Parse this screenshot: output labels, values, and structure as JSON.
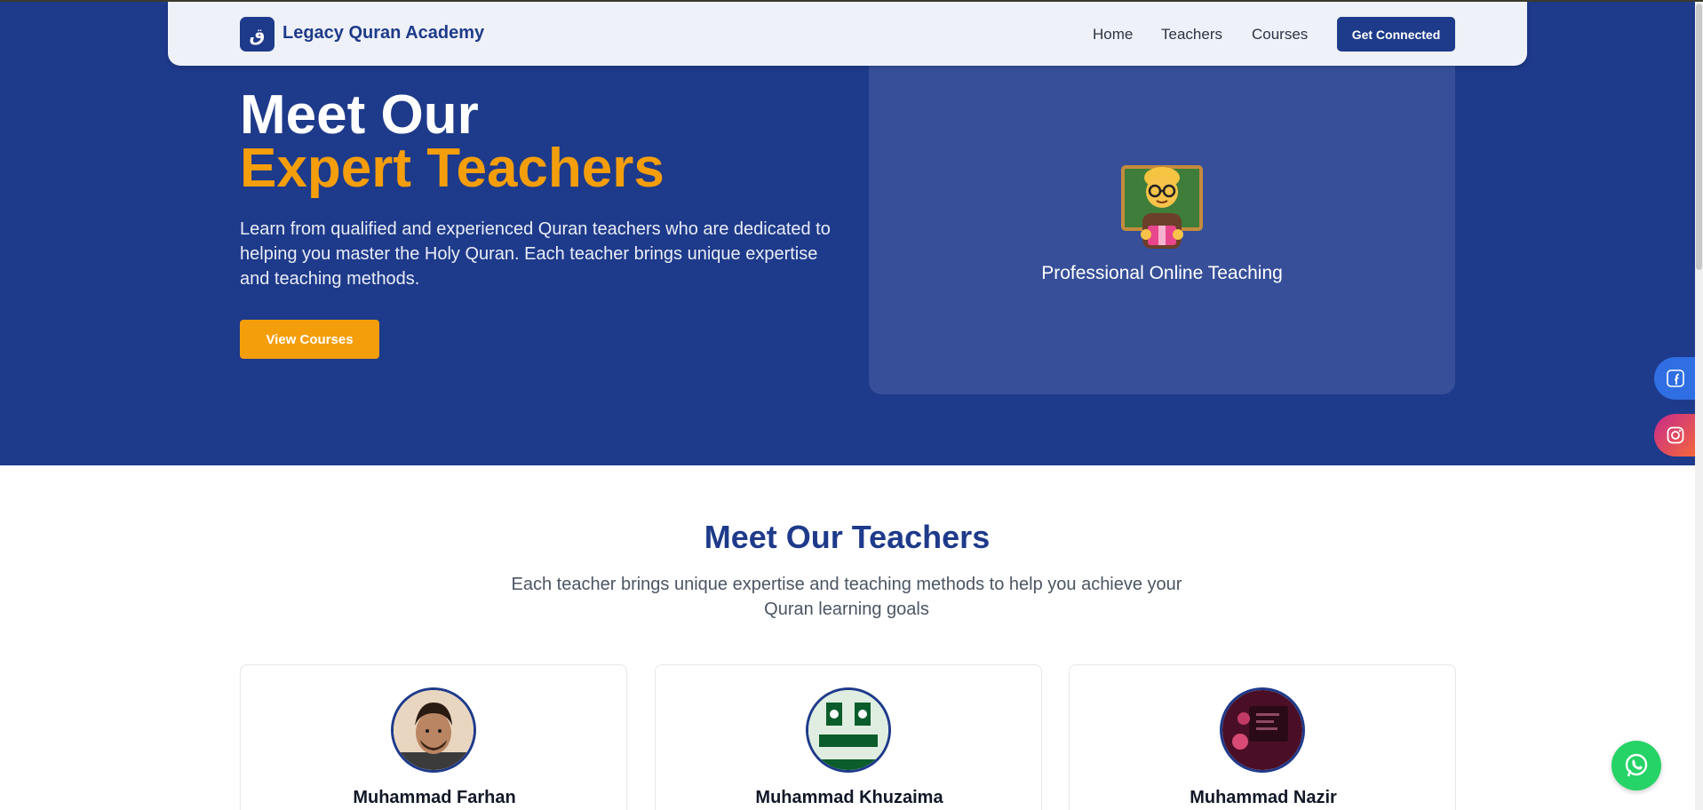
{
  "nav": {
    "logo_glyph": "ق",
    "brand": "Legacy Quran Academy",
    "links": [
      {
        "label": "Home"
      },
      {
        "label": "Teachers"
      },
      {
        "label": "Courses"
      }
    ],
    "cta_label": "Get Connected"
  },
  "hero": {
    "title_line1": "Meet Our",
    "title_line2": "Expert Teachers",
    "description": "Learn from qualified and experienced Quran teachers who are dedicated to helping you master the Holy Quran. Each teacher brings unique expertise and teaching methods.",
    "button_label": "View Courses",
    "card_icon": "teacher-emoji-icon",
    "card_label": "Professional Online Teaching"
  },
  "teachers_section": {
    "title": "Meet Our Teachers",
    "subtitle": "Each teacher brings unique expertise and teaching methods to help you achieve your Quran learning goals",
    "teachers": [
      {
        "name": "Muhammad Farhan"
      },
      {
        "name": "Muhammad Khuzaima"
      },
      {
        "name": "Muhammad Nazir"
      }
    ]
  },
  "social": {
    "facebook_icon": "facebook-icon",
    "instagram_icon": "instagram-icon",
    "whatsapp_icon": "whatsapp-icon"
  },
  "colors": {
    "primary": "#1e3a8a",
    "accent": "#f59e0b",
    "whatsapp": "#25d366"
  }
}
